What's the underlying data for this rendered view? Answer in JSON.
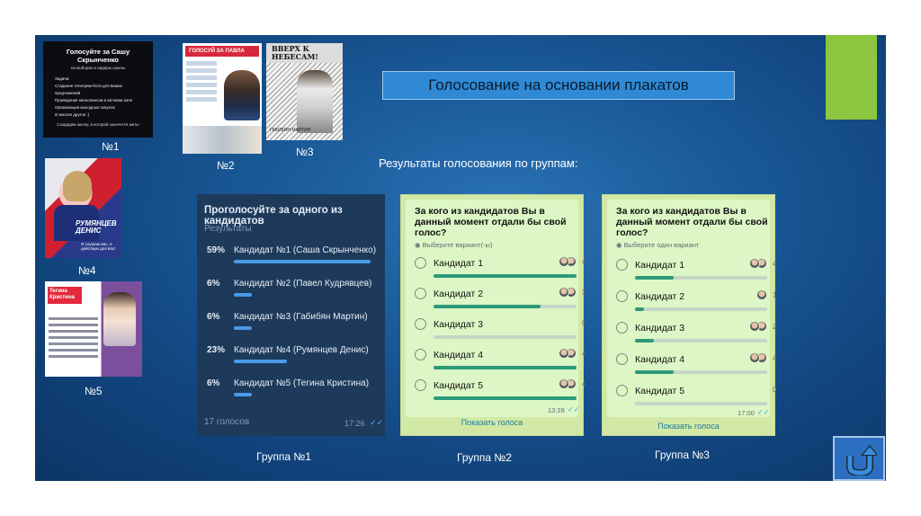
{
  "slide": {
    "title": "Голосование на основании плакатов",
    "subtitle": "Результаты голосования по группам:",
    "accent_green": "#8cc63f",
    "background": "#1a5a99"
  },
  "posters": [
    {
      "label": "№1",
      "heading": "Голосуйте за Сашу Скрынченко",
      "sub": "на выборах в лидеры школы",
      "tasks_title": "Задачи:",
      "tasks": [
        "Создание телеграм-бота для ваших предложений",
        "Проведение киносеансов в актовом зале",
        "Организация выходных покупок",
        "И многое другое :)"
      ],
      "footer": "Создадим школу, в которой захочется жить!"
    },
    {
      "label": "№2",
      "heading": "ГОЛОСУЙ ЗА ПАВЛА"
    },
    {
      "label": "№3",
      "heading": "ВВЕРХ К НЕБЕСАМ!",
      "name": "ГАБИБЯН МАРТИН"
    },
    {
      "label": "№4",
      "name": "РУМЯНЦЕВ ДЕНИС",
      "slogan": "Я слушаю вас, я действую для вас!"
    },
    {
      "label": "№5",
      "name": "Тегина Кристина"
    }
  ],
  "groups": [
    {
      "label": "Группа №1",
      "app": "telegram",
      "question": "Проголосуйте за одного из кандидатов",
      "results_label": "Результаты",
      "options": [
        {
          "pct": "59%",
          "name": "Кандидат №1 (Саша Скрынченко)",
          "fraction": 0.59
        },
        {
          "pct": "6%",
          "name": "Кандидат №2 (Павел Кудрявцев)",
          "fraction": 0.06
        },
        {
          "pct": "6%",
          "name": "Кандидат №3 (Габибян Мартин)",
          "fraction": 0.06
        },
        {
          "pct": "23%",
          "name": "Кандидат №4 (Румянцев Денис)",
          "fraction": 0.23
        },
        {
          "pct": "6%",
          "name": "Кандидат №5 (Тегина Кристина)",
          "fraction": 0.06
        }
      ],
      "votes": "17 голосов",
      "time": "17:26"
    },
    {
      "label": "Группа №2",
      "app": "whatsapp",
      "question": "За кого из кандидатов Вы в данный момент отдали бы свой голос?",
      "hint": "Выберите вариант(-ы)",
      "options": [
        {
          "name": "Кандидат 1",
          "count": "4",
          "fraction": 1.0,
          "avatars": 2
        },
        {
          "name": "Кандидат 2",
          "count": "3",
          "fraction": 0.75,
          "avatars": 2
        },
        {
          "name": "Кандидат 3",
          "count": "0",
          "fraction": 0.0,
          "avatars": 0
        },
        {
          "name": "Кандидат 4",
          "count": "4",
          "fraction": 1.0,
          "avatars": 2
        },
        {
          "name": "Кандидат 5",
          "count": "4",
          "fraction": 1.0,
          "avatars": 2
        }
      ],
      "time": "13:28",
      "show_votes": "Показать голоса"
    },
    {
      "label": "Группа №3",
      "app": "whatsapp",
      "question": "За кого из кандидатов Вы в данный момент отдали бы свой голос?",
      "hint": "Выберите один вариант",
      "options": [
        {
          "name": "Кандидат 1",
          "count": "4",
          "fraction": 0.29,
          "avatars": 2
        },
        {
          "name": "Кандидат 2",
          "count": "1",
          "fraction": 0.07,
          "avatars": 1
        },
        {
          "name": "Кандидат 3",
          "count": "2",
          "fraction": 0.14,
          "avatars": 2
        },
        {
          "name": "Кандидат 4",
          "count": "4",
          "fraction": 0.29,
          "avatars": 2
        },
        {
          "name": "Кандидат 5",
          "count": "0",
          "fraction": 0.0,
          "avatars": 0
        }
      ],
      "time": "17:00",
      "show_votes": "Показать голоса"
    }
  ],
  "nav": {
    "return_icon": "return-arrow-icon"
  }
}
